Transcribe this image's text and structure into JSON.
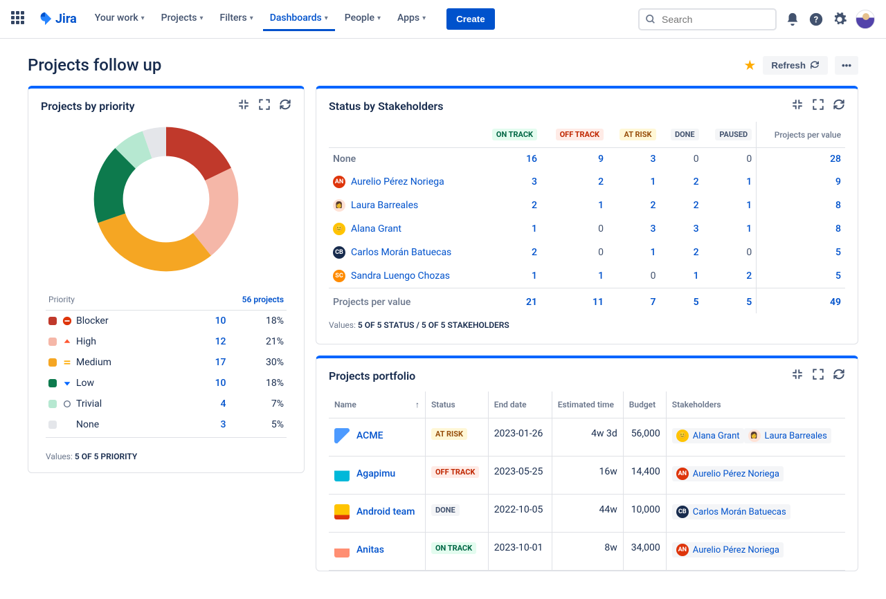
{
  "nav": {
    "items": [
      "Your work",
      "Projects",
      "Filters",
      "Dashboards",
      "People",
      "Apps"
    ],
    "active_index": 3,
    "create": "Create",
    "search_placeholder": "Search",
    "logo_text": "Jira"
  },
  "page": {
    "title": "Projects follow up",
    "refresh": "Refresh"
  },
  "priority_widget": {
    "title": "Projects by priority",
    "header_priority": "Priority",
    "header_count": "56 projects",
    "values_label": "Values:",
    "values_text": "5 OF 5 PRIORITY",
    "rows": [
      {
        "name": "Blocker",
        "count": 10,
        "pct": "18%",
        "color": "#C0392B",
        "icon": "blocker"
      },
      {
        "name": "High",
        "count": 12,
        "pct": "21%",
        "color": "#F5B7A8",
        "icon": "high"
      },
      {
        "name": "Medium",
        "count": 17,
        "pct": "30%",
        "color": "#F5A623",
        "icon": "medium"
      },
      {
        "name": "Low",
        "count": 10,
        "pct": "18%",
        "color": "#0D7A4D",
        "icon": "low"
      },
      {
        "name": "Trivial",
        "count": 4,
        "pct": "7%",
        "color": "#B6E8D1",
        "icon": "trivial"
      },
      {
        "name": "None",
        "count": 3,
        "pct": "5%",
        "color": "#E4E6EA",
        "icon": "none"
      }
    ]
  },
  "chart_data": {
    "type": "pie",
    "title": "Projects by priority",
    "categories": [
      "Blocker",
      "High",
      "Medium",
      "Low",
      "Trivial",
      "None"
    ],
    "values": [
      10,
      12,
      17,
      10,
      4,
      3
    ],
    "colors": [
      "#C0392B",
      "#F5B7A8",
      "#F5A623",
      "#0D7A4D",
      "#B6E8D1",
      "#E4E6EA"
    ],
    "total": 56
  },
  "stakeholders_widget": {
    "title": "Status by Stakeholders",
    "col_projects": "Projects per value",
    "status_cols": [
      {
        "label": "ON TRACK",
        "cls": "b-ontrack"
      },
      {
        "label": "OFF TRACK",
        "cls": "b-offtrack"
      },
      {
        "label": "AT RISK",
        "cls": "b-atrisk"
      },
      {
        "label": "DONE",
        "cls": "b-done"
      },
      {
        "label": "PAUSED",
        "cls": "b-paused"
      }
    ],
    "rows": [
      {
        "name": "None",
        "avatar": null,
        "vals": [
          16,
          9,
          3,
          0,
          0
        ],
        "total": 28
      },
      {
        "name": "Aurelio Pérez Noriega",
        "avatar": {
          "bg": "#DE350B",
          "txt": "AN"
        },
        "vals": [
          3,
          2,
          1,
          2,
          1
        ],
        "total": 9
      },
      {
        "name": "Laura Barreales",
        "avatar": {
          "bg": "#FFE2D6",
          "txt": "👩"
        },
        "vals": [
          2,
          1,
          2,
          2,
          1
        ],
        "total": 8
      },
      {
        "name": "Alana Grant",
        "avatar": {
          "bg": "#FFC400",
          "txt": "😊"
        },
        "vals": [
          1,
          0,
          3,
          3,
          1
        ],
        "total": 8
      },
      {
        "name": "Carlos Morán Batuecas",
        "avatar": {
          "bg": "#172B4D",
          "txt": "CB"
        },
        "vals": [
          2,
          0,
          1,
          2,
          0
        ],
        "total": 5
      },
      {
        "name": "Sandra Luengo Chozas",
        "avatar": {
          "bg": "#FF8B00",
          "txt": "SC"
        },
        "vals": [
          1,
          1,
          0,
          1,
          2
        ],
        "total": 5
      }
    ],
    "totals_label": "Projects per value",
    "totals": [
      21,
      11,
      7,
      5,
      5
    ],
    "grand_total": 49,
    "values_label": "Values:",
    "values_text": "5 OF 5 STATUS / 5 OF 5 STAKEHOLDERS"
  },
  "portfolio_widget": {
    "title": "Projects portfolio",
    "cols": [
      "Name",
      "Status",
      "End date",
      "Estimated time",
      "Budget",
      "Stakeholders"
    ],
    "rows": [
      {
        "name": "ACME",
        "icon_bg": "linear-gradient(135deg,#4C9AFF 0 60%, #fff 60%)",
        "status": {
          "label": "AT RISK",
          "cls": "b-atrisk"
        },
        "end": "2023-01-26",
        "est": "4w 3d",
        "budget": "56,000",
        "stake": [
          {
            "name": "Alana Grant",
            "bg": "#FFC400",
            "txt": "😊"
          },
          {
            "name": "Laura Barreales",
            "bg": "#FFE2D6",
            "txt": "👩"
          }
        ]
      },
      {
        "name": "Agapimu",
        "icon_bg": "linear-gradient(#fff 0 30%, #00B8D9 30%)",
        "status": {
          "label": "OFF TRACK",
          "cls": "b-offtrack"
        },
        "end": "2023-05-25",
        "est": "16w",
        "budget": "14,400",
        "stake": [
          {
            "name": "Aurelio Pérez Noriega",
            "bg": "#DE350B",
            "txt": "AN"
          }
        ]
      },
      {
        "name": "Android team",
        "icon_bg": "linear-gradient(#FFC400 0 70%, #DE350B 70%)",
        "status": {
          "label": "DONE",
          "cls": "b-done"
        },
        "end": "2022-10-05",
        "est": "44w",
        "budget": "10,000",
        "stake": [
          {
            "name": "Carlos Morán Batuecas",
            "bg": "#172B4D",
            "txt": "CB"
          }
        ]
      },
      {
        "name": "Anitas",
        "icon_bg": "linear-gradient(#fff 0 40%, #FF8F73 40%)",
        "status": {
          "label": "ON TRACK",
          "cls": "b-ontrack"
        },
        "end": "2023-10-01",
        "est": "8w",
        "budget": "34,000",
        "stake": [
          {
            "name": "Aurelio Pérez Noriega",
            "bg": "#DE350B",
            "txt": "AN"
          }
        ]
      }
    ]
  }
}
